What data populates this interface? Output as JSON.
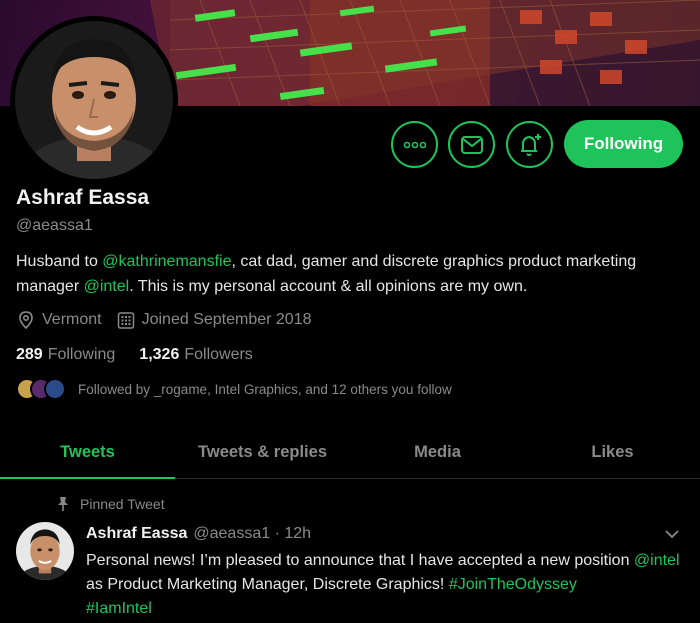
{
  "profile": {
    "name": "Ashraf Eassa",
    "handle": "@aeassa1",
    "bio_parts": {
      "p1": "Husband to ",
      "mention1": "@kathrinemansfie",
      "p2": ", cat dad, gamer and discrete graphics product marketing manager ",
      "mention2": "@intel",
      "p3": ". This is my personal account & all opinions are my own."
    },
    "location": "Vermont",
    "joined": "Joined September 2018",
    "following_count": "289",
    "following_label": "Following",
    "followers_count": "1,326",
    "followers_label": "Followers",
    "followed_by": "Followed by _rogame, Intel Graphics, and 12 others you follow"
  },
  "actions": {
    "more_icon": "more-icon",
    "message_icon": "envelope-icon",
    "notify_icon": "bell-plus-icon",
    "follow_label": "Following"
  },
  "tabs": [
    {
      "label": "Tweets",
      "active": true
    },
    {
      "label": "Tweets & replies",
      "active": false
    },
    {
      "label": "Media",
      "active": false
    },
    {
      "label": "Likes",
      "active": false
    }
  ],
  "tweet": {
    "pinned_label": "Pinned Tweet",
    "author": "Ashraf Eassa",
    "handle_time": "@aeassa1 · 12h",
    "text_p1": "Personal news! I’m pleased to announce that I have accepted a new position ",
    "mention": "@intel",
    "text_p2": " as Product Marketing Manager, Discrete Graphics! ",
    "hashtag1": "#JoinTheOdyssey",
    "hashtag2": "#IamIntel"
  },
  "colors": {
    "accent": "#1ec45a",
    "background": "#000000",
    "muted": "#8a8a8a"
  }
}
